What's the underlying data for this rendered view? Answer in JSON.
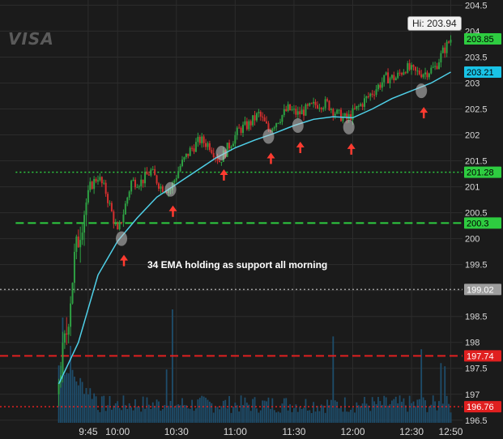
{
  "logo": "VISA",
  "annotation": "34 EMA holding as support all morning",
  "high_label": "Hi: 203.94",
  "colors": {
    "background": "#1b1b1b",
    "up_candle": "#2ea043",
    "down_candle": "#d32f2f",
    "ema": "#4fd0e8",
    "volume": "#1e4d6b",
    "grid": "#2c2c2c"
  },
  "chart_data": {
    "type": "candlestick",
    "y_ticks": [
      196.5,
      197,
      197.5,
      198,
      198.5,
      199,
      199.5,
      200,
      200.5,
      201,
      201.5,
      202,
      202.5,
      203,
      203.5,
      204,
      204.5
    ],
    "ylim": [
      196.45,
      204.6
    ],
    "x_ticks": [
      {
        "label": "9:45",
        "minute": 15
      },
      {
        "label": "10:00",
        "minute": 30
      },
      {
        "label": "10:30",
        "minute": 60
      },
      {
        "label": "11:00",
        "minute": 90
      },
      {
        "label": "11:30",
        "minute": 120
      },
      {
        "label": "12:00",
        "minute": 150
      },
      {
        "label": "12:30",
        "minute": 180
      },
      {
        "label": "12:50",
        "minute": 200
      }
    ],
    "levels": [
      {
        "value": 201.28,
        "label": "201.28",
        "color": "#2ecc40",
        "style": "dotted"
      },
      {
        "value": 200.3,
        "label": "200.3",
        "color": "#2ecc40",
        "style": "dashed"
      },
      {
        "value": 199.02,
        "label": "199.02",
        "color": "#9e9e9e",
        "style": "dotted"
      },
      {
        "value": 197.74,
        "label": "197.74",
        "color": "#e02020",
        "style": "dashed"
      },
      {
        "value": 196.76,
        "label": "196.76",
        "color": "#e02020",
        "style": "dotted"
      }
    ],
    "price_tags": [
      {
        "value": 203.85,
        "label": "203.85",
        "color": "#2ecc40"
      },
      {
        "value": 203.21,
        "label": "203.21",
        "color": "#19c3e6"
      }
    ],
    "support_touches": [
      {
        "minute": 32,
        "value": 200.0
      },
      {
        "minute": 57,
        "value": 200.95
      },
      {
        "minute": 83,
        "value": 201.65
      },
      {
        "minute": 107,
        "value": 201.97
      },
      {
        "minute": 122,
        "value": 202.18
      },
      {
        "minute": 148,
        "value": 202.15
      },
      {
        "minute": 185,
        "value": 202.85
      }
    ],
    "price_path": [
      [
        0,
        197.3
      ],
      [
        4,
        198.2
      ],
      [
        8,
        199.6
      ],
      [
        12,
        200.4
      ],
      [
        16,
        201.0
      ],
      [
        20,
        201.2
      ],
      [
        24,
        200.9
      ],
      [
        27,
        200.5
      ],
      [
        30,
        200.1
      ],
      [
        33,
        200.5
      ],
      [
        37,
        201.1
      ],
      [
        42,
        201.1
      ],
      [
        47,
        201.3
      ],
      [
        52,
        201.0
      ],
      [
        57,
        200.95
      ],
      [
        62,
        201.4
      ],
      [
        67,
        201.7
      ],
      [
        72,
        201.9
      ],
      [
        77,
        201.8
      ],
      [
        82,
        201.5
      ],
      [
        87,
        201.8
      ],
      [
        92,
        202.1
      ],
      [
        97,
        202.2
      ],
      [
        102,
        202.4
      ],
      [
        107,
        202.1
      ],
      [
        112,
        202.3
      ],
      [
        117,
        202.5
      ],
      [
        122,
        202.4
      ],
      [
        127,
        202.5
      ],
      [
        132,
        202.6
      ],
      [
        137,
        202.6
      ],
      [
        142,
        202.4
      ],
      [
        147,
        202.3
      ],
      [
        152,
        202.5
      ],
      [
        157,
        202.7
      ],
      [
        162,
        202.9
      ],
      [
        167,
        203.1
      ],
      [
        172,
        203.1
      ],
      [
        177,
        203.3
      ],
      [
        182,
        203.2
      ],
      [
        187,
        203.2
      ],
      [
        192,
        203.3
      ],
      [
        196,
        203.6
      ],
      [
        200,
        203.85
      ]
    ],
    "ema_path": [
      [
        0,
        197.2
      ],
      [
        10,
        198.0
      ],
      [
        20,
        199.3
      ],
      [
        30,
        199.95
      ],
      [
        40,
        200.4
      ],
      [
        50,
        200.8
      ],
      [
        60,
        201.05
      ],
      [
        70,
        201.3
      ],
      [
        80,
        201.55
      ],
      [
        90,
        201.75
      ],
      [
        100,
        201.9
      ],
      [
        110,
        202.03
      ],
      [
        120,
        202.18
      ],
      [
        130,
        202.3
      ],
      [
        140,
        202.35
      ],
      [
        150,
        202.33
      ],
      [
        160,
        202.5
      ],
      [
        170,
        202.7
      ],
      [
        180,
        202.85
      ],
      [
        190,
        203.0
      ],
      [
        200,
        203.21
      ]
    ]
  }
}
